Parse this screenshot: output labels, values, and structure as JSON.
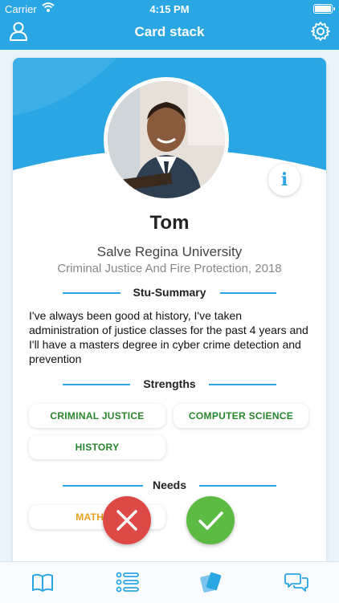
{
  "status_bar": {
    "carrier": "Carrier",
    "time": "4:15 PM"
  },
  "nav": {
    "title": "Card stack",
    "left_icon": "user-icon",
    "right_icon": "gear-icon"
  },
  "profile": {
    "name": "Tom",
    "university": "Salve Regina University",
    "major": "Criminal Justice And Fire Protection, 2018",
    "info_label": "i"
  },
  "summary": {
    "heading": "Stu-Summary",
    "text": "I've always been good at history, I've taken administration of justice classes for the past 4 years and I'll have a masters degree in cyber crime detection and prevention"
  },
  "strengths": {
    "heading": "Strengths",
    "items": [
      "CRIMINAL JUSTICE",
      "COMPUTER SCIENCE",
      "HISTORY"
    ]
  },
  "needs": {
    "heading": "Needs",
    "items": [
      "MATHEM"
    ]
  },
  "actions": {
    "reject_icon": "x-icon",
    "accept_icon": "check-icon"
  },
  "tabs": [
    "book-icon",
    "list-icon",
    "cards-icon",
    "chat-icon"
  ],
  "colors": {
    "primary": "#2aa6e3",
    "strength_text": "#28862c",
    "need_text": "#e6a21d",
    "reject": "#dd4a46",
    "accept": "#5dbb43"
  }
}
